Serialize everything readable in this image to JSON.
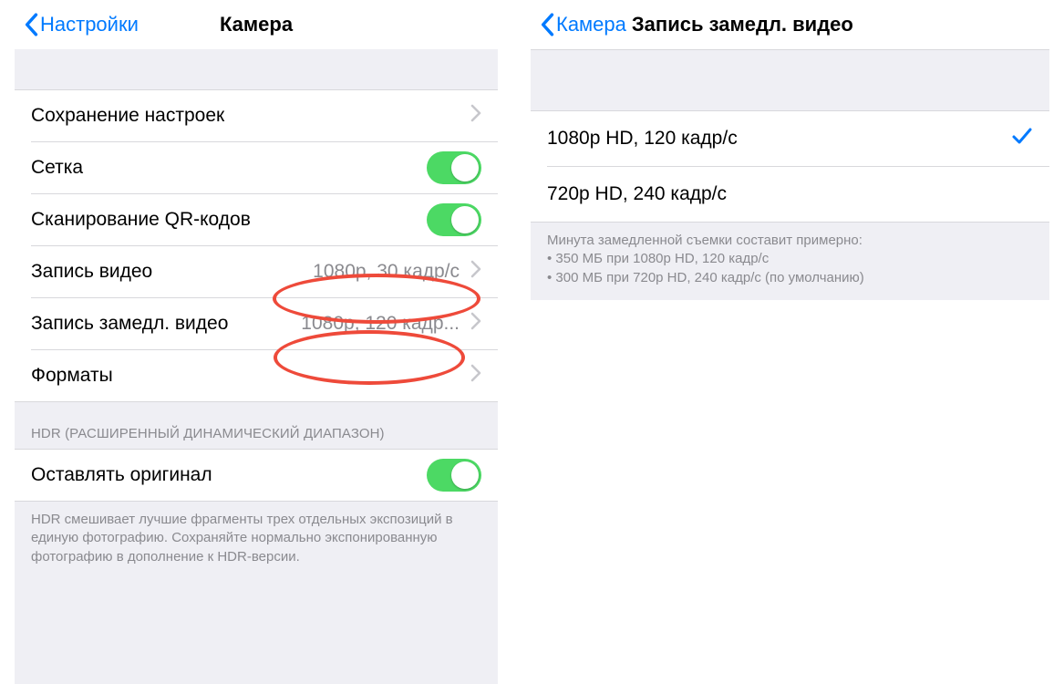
{
  "left": {
    "back": "Настройки",
    "title": "Камера",
    "rows": {
      "save": {
        "label": "Сохранение настроек"
      },
      "grid": {
        "label": "Сетка"
      },
      "qr": {
        "label": "Сканирование QR-кодов"
      },
      "video": {
        "label": "Запись видео",
        "value": "1080p, 30 кадр/с"
      },
      "slomo": {
        "label": "Запись замедл. видео",
        "value": "1080p, 120 кадр..."
      },
      "formats": {
        "label": "Форматы"
      }
    },
    "hdrHeader": "HDR (РАСШИРЕННЫЙ ДИНАМИЧЕСКИЙ ДИАПАЗОН)",
    "hdrRow": {
      "label": "Оставлять оригинал"
    },
    "hdrFooter": "HDR смешивает лучшие фрагменты трех отдельных экспозиций в единую фотографию. Сохраняйте нормально экспонированную фотографию в дополнение к HDR-версии."
  },
  "right": {
    "back": "Камера",
    "title": "Запись замедл. видео",
    "options": {
      "o1": "1080p HD, 120 кадр/с",
      "o2": "720p HD, 240 кадр/с"
    },
    "footer": "Минута замедленной съемки составит примерно:\n• 350 МБ при 1080p HD, 120 кадр/с\n• 300 МБ при 720p HD, 240 кадр/с (по умолчанию)"
  }
}
